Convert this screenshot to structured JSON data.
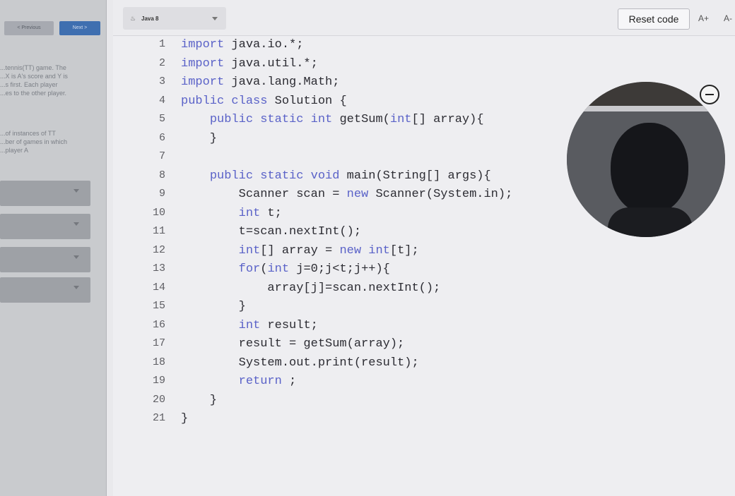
{
  "left_panel": {
    "prev_label": "< Previous",
    "next_label": "Next >",
    "problem_lines_1": [
      "...tennis(TT) game. The",
      "...X is A's score and Y is",
      "...s first. Each player",
      "...es to the other player."
    ],
    "problem_lines_2": [
      "...of instances of TT",
      "...ber of games in which",
      "...player A"
    ]
  },
  "toolbar": {
    "language": "Java 8",
    "language_icon": "java-icon",
    "reset_label": "Reset code",
    "font_increase": "A+",
    "font_decrease": "A-"
  },
  "code_lines": [
    {
      "n": "1",
      "text": "import java.io.*;"
    },
    {
      "n": "2",
      "text": "import java.util.*;"
    },
    {
      "n": "3",
      "text": "import java.lang.Math;"
    },
    {
      "n": "4",
      "text": "public class Solution {"
    },
    {
      "n": "5",
      "text": "    public static int getSum(int[] array){"
    },
    {
      "n": "6",
      "text": "    }"
    },
    {
      "n": "7",
      "text": ""
    },
    {
      "n": "8",
      "text": "    public static void main(String[] args){"
    },
    {
      "n": "9",
      "text": "        Scanner scan = new Scanner(System.in);"
    },
    {
      "n": "10",
      "text": "        int t;"
    },
    {
      "n": "11",
      "text": "        t=scan.nextInt();"
    },
    {
      "n": "12",
      "text": "        int[] array = new int[t];"
    },
    {
      "n": "13",
      "text": "        for(int j=0;j<t;j++){"
    },
    {
      "n": "14",
      "text": "            array[j]=scan.nextInt();"
    },
    {
      "n": "15",
      "text": "        }"
    },
    {
      "n": "16",
      "text": "        int result;"
    },
    {
      "n": "17",
      "text": "        result = getSum(array);"
    },
    {
      "n": "18",
      "text": "        System.out.print(result);"
    },
    {
      "n": "19",
      "text": "        return ;"
    },
    {
      "n": "20",
      "text": "    }"
    },
    {
      "n": "21",
      "text": "}"
    }
  ],
  "colors": {
    "keyword": "#5a62c8",
    "text": "#2c2c33",
    "line_number": "#5d5d62",
    "accent": "#3f6fb0"
  },
  "webcam": {
    "icon": "minimize-icon"
  }
}
